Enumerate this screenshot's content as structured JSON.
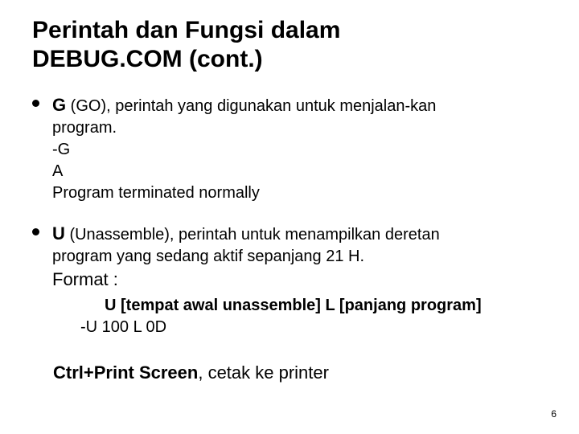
{
  "title_line1": "Perintah dan Fungsi dalam",
  "title_line2": "DEBUG.COM  (cont.)",
  "items": [
    {
      "cmd": "G",
      "desc_first": " (GO), perintah yang digunakan untuk menjalan-kan",
      "lines": [
        "program.",
        "-G",
        "A",
        "Program terminated normally"
      ]
    },
    {
      "cmd": "U",
      "desc_first": " (Unassemble), perintah untuk menampilkan deretan",
      "lines": [
        "program yang sedang aktif sepanjang 21 H."
      ],
      "format_label": "Format :",
      "format_syntax": "U [tempat awal unassemble] L [panjang program]",
      "format_example": "-U 100 L  0D"
    }
  ],
  "ctrl_bold": "Ctrl+Print Screen",
  "ctrl_rest": ", cetak ke printer",
  "page_number": "6"
}
